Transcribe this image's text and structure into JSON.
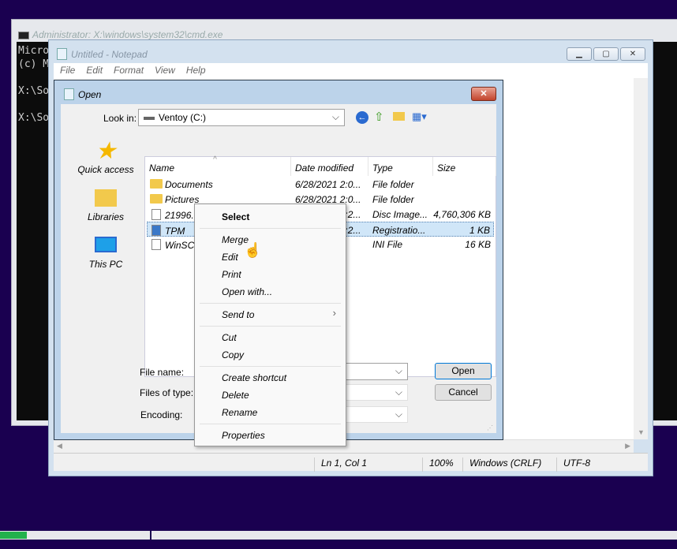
{
  "colors": {
    "desktop": "#1a0050",
    "progress": "#22b14c",
    "selection": "#d0e6f8"
  },
  "cmd": {
    "title": "Administrator: X:\\windows\\system32\\cmd.exe",
    "lines": [
      "Micro",
      "(c) M",
      "",
      "X:\\So",
      "",
      "X:\\So"
    ]
  },
  "notepad": {
    "title": "Untitled - Notepad",
    "menu": [
      "File",
      "Edit",
      "Format",
      "View",
      "Help"
    ],
    "status": {
      "position": "Ln 1, Col 1",
      "zoom": "100%",
      "line_ending": "Windows (CRLF)",
      "encoding": "UTF-8"
    }
  },
  "dialog": {
    "title": "Open",
    "look_in_label": "Look in:",
    "look_in_value": "Ventoy (C:)",
    "places": [
      {
        "label": "Quick access",
        "icon": "star-icon"
      },
      {
        "label": "Libraries",
        "icon": "folder-icon"
      },
      {
        "label": "This PC",
        "icon": "monitor-icon"
      }
    ],
    "columns": [
      "Name",
      "Date modified",
      "Type",
      "Size"
    ],
    "files": [
      {
        "name": "Documents",
        "date": "6/28/2021 2:0...",
        "type": "File folder",
        "size": "",
        "icon": "folder-icon"
      },
      {
        "name": "Pictures",
        "date": "6/28/2021 2:0...",
        "type": "File folder",
        "size": "",
        "icon": "folder-icon"
      },
      {
        "name": "21996.1.210529-1541.co_rele...",
        "date": "6/20/2021 3:2...",
        "type": "Disc Image...",
        "size": "4,760,306 KB",
        "icon": "disc-image-icon"
      },
      {
        "name": "TPM",
        "date": "6/20/2021 5:2...",
        "type": "Registratio...",
        "size": "1 KB",
        "icon": "registry-file-icon",
        "selected": true
      },
      {
        "name": "WinSCP.",
        "date": "...",
        "type": "INI File",
        "size": "16 KB",
        "icon": "file-icon"
      }
    ],
    "file_name_label": "File name:",
    "files_of_type_label": "Files of type:",
    "encoding_label": "Encoding:",
    "open_button": "Open",
    "cancel_button": "Cancel"
  },
  "context_menu": {
    "items": [
      {
        "label": "Select",
        "bold": true
      },
      {
        "label": "Merge"
      },
      {
        "label": "Edit"
      },
      {
        "label": "Print"
      },
      {
        "label": "Open with..."
      },
      {
        "label": "Send to",
        "submenu": true
      },
      {
        "label": "Cut"
      },
      {
        "label": "Copy"
      },
      {
        "label": "Create shortcut"
      },
      {
        "label": "Delete"
      },
      {
        "label": "Rename"
      },
      {
        "label": "Properties"
      }
    ]
  },
  "progress": {
    "fraction": 0.04
  }
}
